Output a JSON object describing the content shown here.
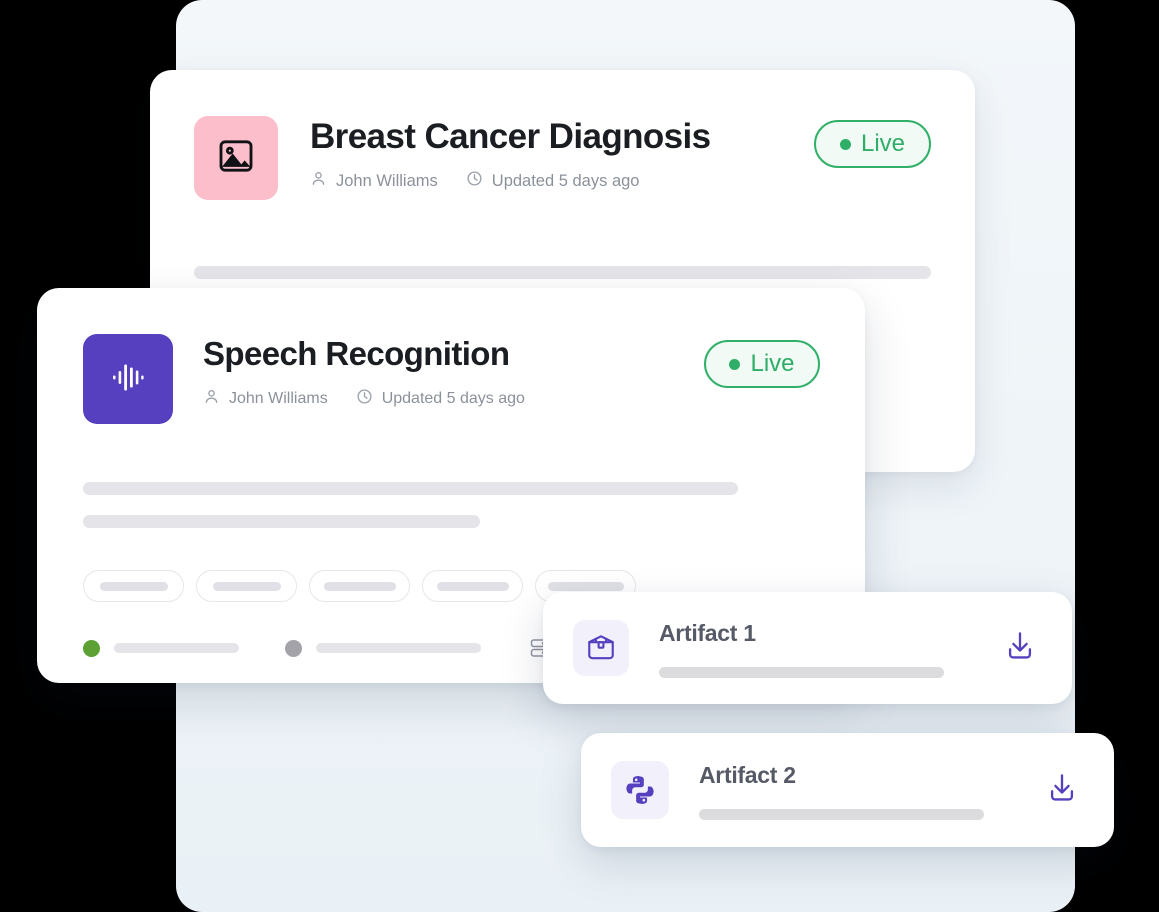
{
  "background": {
    "color": "#000000",
    "panel_color": "#f1f6fa"
  },
  "theme": {
    "accent_purple": "#5640bf",
    "live_green": "#2fae68",
    "live_green_bg": "#f1faf4",
    "thumb_pink": "#fcbecb",
    "skeleton_gray": "#e4e4e9",
    "title_color": "#1a1d21",
    "meta_color": "#8b919b"
  },
  "cards": [
    {
      "id": "breast-cancer",
      "title": "Breast Cancer Diagnosis",
      "thumb_icon": "image-icon",
      "thumb_color": "#fcbecb",
      "author": "John Williams",
      "author_icon": "user-icon",
      "updated": "Updated 5 days ago",
      "updated_icon": "clock-icon",
      "status": {
        "label": "Live",
        "dot_color": "#2fae68"
      }
    },
    {
      "id": "speech-recognition",
      "title": "Speech Recognition",
      "thumb_icon": "waveform-icon",
      "thumb_color": "#5640bf",
      "author": "John Williams",
      "author_icon": "user-icon",
      "updated": "Updated 5 days ago",
      "updated_icon": "clock-icon",
      "status": {
        "label": "Live",
        "dot_color": "#2fae68"
      },
      "tag_pills": 5,
      "status_indicators": [
        {
          "dot_color": "#5da033"
        },
        {
          "dot_color": "#a3a3a9"
        },
        {
          "icon": "server-icon"
        }
      ]
    }
  ],
  "artifacts": [
    {
      "id": "artifact-1",
      "title": "Artifact 1",
      "icon": "package-box-icon",
      "icon_color": "#5640bf",
      "action_icon": "download-icon",
      "action_color": "#5640bf"
    },
    {
      "id": "artifact-2",
      "title": "Artifact 2",
      "icon": "python-icon",
      "icon_color": "#5640bf",
      "action_icon": "download-icon",
      "action_color": "#5640bf"
    }
  ]
}
